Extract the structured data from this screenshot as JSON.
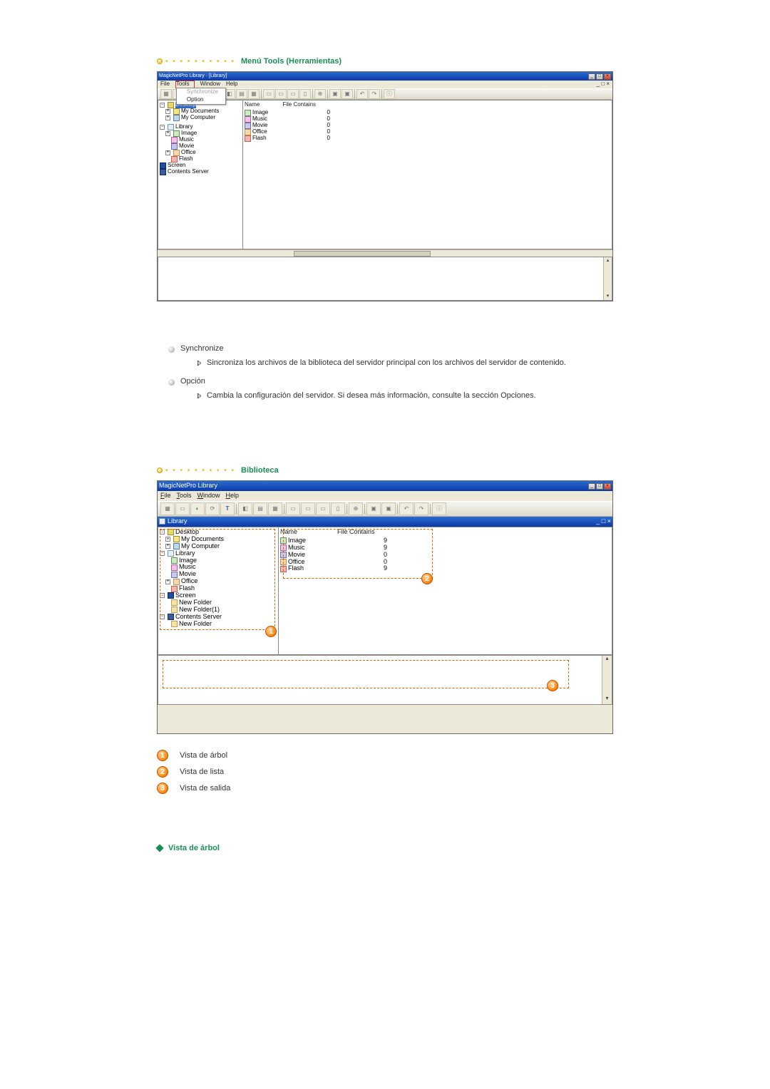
{
  "section1_title": "Menú Tools (Herramientas)",
  "win1": {
    "title": "MagicNetPro Library · [Library]",
    "menus": {
      "file": "File",
      "tools": "Tools",
      "window": "Window",
      "help": "Help"
    },
    "tools_menu": {
      "sync": "Synchronize",
      "option": "Option"
    },
    "tree": {
      "desktop": "Desktop",
      "mydocs": "My Documents",
      "mycomp": "My Computer",
      "library": "Library",
      "image": "Image",
      "music": "Music",
      "movie": "Movie",
      "office": "Office",
      "flash": "Flash",
      "screen": "Screen",
      "contents_server": "Contents Server"
    },
    "list": {
      "col_name": "Name",
      "col_fc": "File Contains",
      "rows": [
        {
          "name": "Image",
          "fc": "0"
        },
        {
          "name": "Music",
          "fc": "0"
        },
        {
          "name": "Movie",
          "fc": "0"
        },
        {
          "name": "Office",
          "fc": "0"
        },
        {
          "name": "Flash",
          "fc": "0"
        }
      ]
    }
  },
  "body": {
    "synchronize": "Synchronize",
    "synchronize_desc": "Sincroniza los archivos de la biblioteca del servidor principal con los archivos del servidor de contenido.",
    "opcion": "Opción",
    "opcion_desc": "Cambia la configuración del servidor. Si desea más información, consulte la sección Opciones."
  },
  "section2_title": "Biblioteca",
  "win2": {
    "title": "MagicNetPro Library",
    "inner_title": "Library",
    "menus": {
      "file": "File",
      "tools": "Tools",
      "window": "Window",
      "help": "Help"
    },
    "tree": {
      "desktop": "Desktop",
      "mydocs": "My Documents",
      "mycomp": "My Computer",
      "library": "Library",
      "image": "Image",
      "music": "Music",
      "movie": "Movie",
      "office": "Office",
      "flash": "Flash",
      "screen": "Screen",
      "newfolder": "New Folder",
      "newfolder1": "New Folder(1)",
      "contents_server": "Contents Server",
      "cs_newfolder": "New Folder"
    },
    "list": {
      "col_name": "Name",
      "col_fc": "File Contains",
      "rows": [
        {
          "name": "Image",
          "fc": "9"
        },
        {
          "name": "Music",
          "fc": "9"
        },
        {
          "name": "Movie",
          "fc": "0"
        },
        {
          "name": "Office",
          "fc": "0"
        },
        {
          "name": "Flash",
          "fc": "9"
        }
      ]
    },
    "callouts": {
      "c1": "1",
      "c2": "2",
      "c3": "3"
    }
  },
  "legend": {
    "l1": "Vista de árbol",
    "l2": "Vista de lista",
    "l3": "Vista de salida"
  },
  "subsection_title": "Vista de árbol"
}
